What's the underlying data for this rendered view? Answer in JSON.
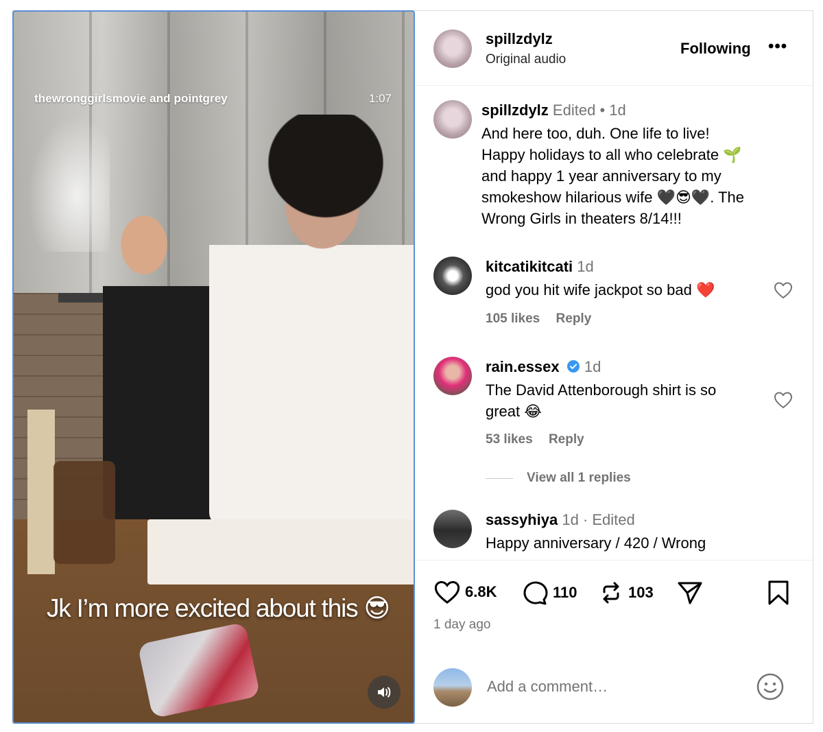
{
  "video": {
    "channel": "thewronggirlsmovie and pointgrey",
    "duration": "1:07",
    "caption": "Jk I’m more excited about this 😎"
  },
  "header": {
    "username": "spillzdylz",
    "audio": "Original audio",
    "following_label": "Following",
    "more_label": "•••"
  },
  "post_caption": {
    "username": "spillzdylz",
    "edited": "Edited",
    "separator": "•",
    "time": "1d",
    "text": "And here too, duh. One life to live!\nHappy holidays to all who celebrate 🌱\nand happy 1 year anniversary to my\nsmokeshow hilarious wife 🖤😎🖤. The\nWrong Girls in theaters 8/14!!!"
  },
  "comments": [
    {
      "username": "kitcatikitcati",
      "time": "1d",
      "text": "god you hit wife jackpot so bad ❤️",
      "likes": "105 likes",
      "reply_label": "Reply"
    },
    {
      "username": "rain.essex",
      "time": "1d",
      "text": "The David Attenborough shirt is so\ngreat 😂",
      "likes": "53 likes",
      "reply_label": "Reply"
    },
    {
      "username": "sassyhiya",
      "time": "1d",
      "edited": "· Edited",
      "text": "Happy anniversary / 420 / Wrong"
    }
  ],
  "view_replies_label": "View all 1 replies",
  "actions": {
    "likes": "6.8K",
    "comments": "110",
    "reposts": "103",
    "posted": "1 day ago"
  },
  "add_comment": {
    "placeholder": "Add a comment…"
  }
}
